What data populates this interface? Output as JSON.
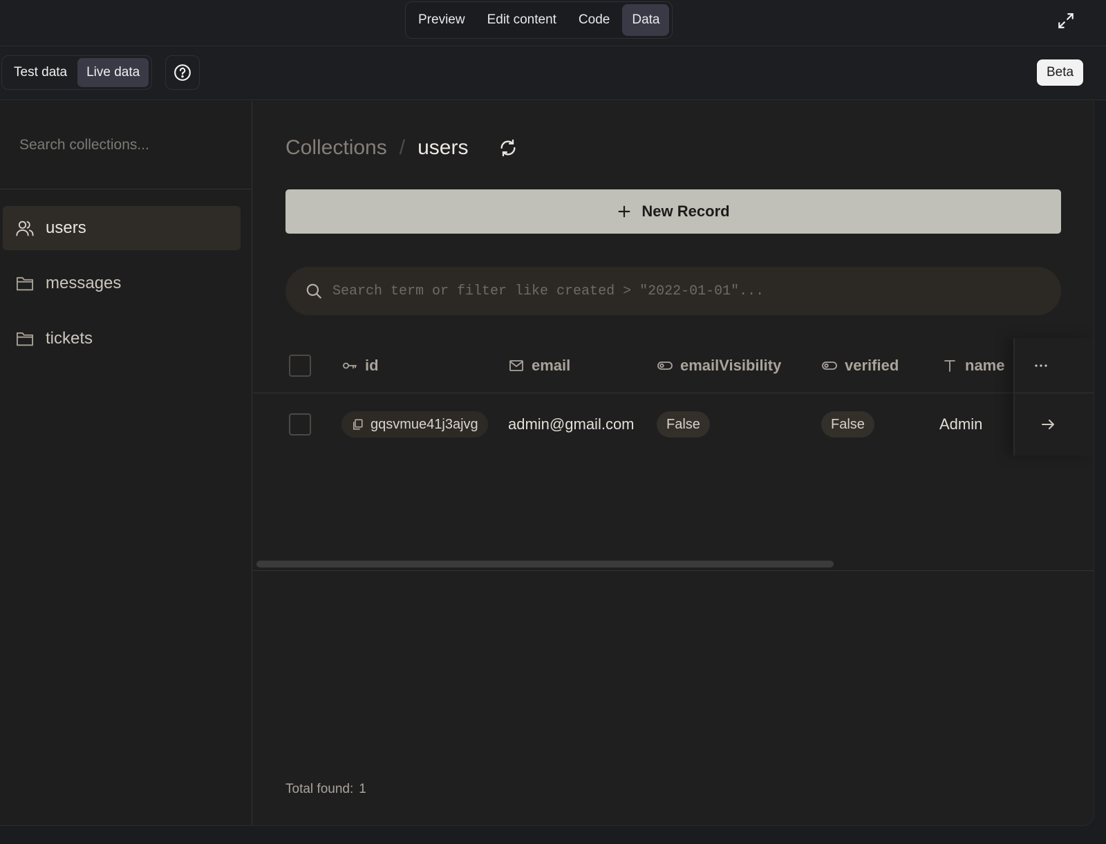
{
  "top_tabs": [
    {
      "label": "Preview",
      "active": false
    },
    {
      "label": "Edit content",
      "active": false
    },
    {
      "label": "Code",
      "active": false
    },
    {
      "label": "Data",
      "active": true
    }
  ],
  "data_mode": {
    "test_label": "Test data",
    "live_label": "Live data",
    "active": "live"
  },
  "beta_label": "Beta",
  "sidebar": {
    "search_placeholder": "Search collections...",
    "collections": [
      {
        "label": "users",
        "icon": "users-icon",
        "active": true
      },
      {
        "label": "messages",
        "icon": "folder-icon",
        "active": false
      },
      {
        "label": "tickets",
        "icon": "folder-icon",
        "active": false
      }
    ]
  },
  "breadcrumb": {
    "root": "Collections",
    "separator": "/",
    "current": "users"
  },
  "new_record_label": "New Record",
  "record_search_placeholder": "Search term or filter like created > \"2022-01-01\"...",
  "table": {
    "columns": [
      {
        "label": "id",
        "icon": "key-icon"
      },
      {
        "label": "email",
        "icon": "mail-icon"
      },
      {
        "label": "emailVisibility",
        "icon": "toggle-icon"
      },
      {
        "label": "verified",
        "icon": "toggle-icon"
      },
      {
        "label": "name",
        "icon": "text-icon"
      }
    ],
    "rows": [
      {
        "id": "gqsvmue41j3ajvg",
        "email": "admin@gmail.com",
        "emailVisibility": "False",
        "verified": "False",
        "name": "Admin"
      }
    ]
  },
  "total": {
    "label": "Total found:",
    "count": "1"
  },
  "colors": {
    "accent_tab": "#3a3a47",
    "new_record_bg": "#c1c0b8",
    "active_collection_bg": "#2f2c28"
  }
}
